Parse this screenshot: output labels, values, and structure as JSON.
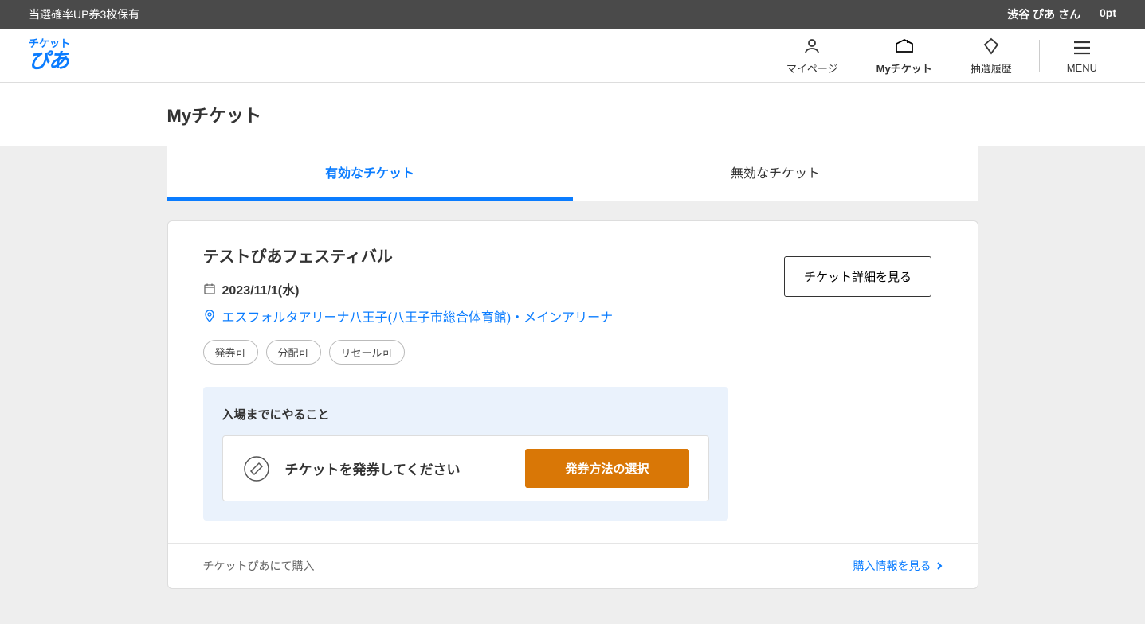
{
  "topbar": {
    "left": "当選確率UP券3枚保有",
    "username": "渋谷 ぴあ さん",
    "points": "0pt"
  },
  "logo": {
    "top": "チケット",
    "bottom": "ぴあ"
  },
  "nav": {
    "mypage": "マイページ",
    "myticket": "Myチケット",
    "lottery": "抽選履歴",
    "menu": "MENU"
  },
  "page": {
    "title": "Myチケット"
  },
  "tabs": {
    "valid": "有効なチケット",
    "invalid": "無効なチケット"
  },
  "ticket": {
    "title": "テストぴあフェスティバル",
    "date": "2023/11/1(水)",
    "venue": "エスフォルタアリーナ八王子(八王子市総合体育館)・メインアリーナ",
    "badges": [
      "発券可",
      "分配可",
      "リセール可"
    ],
    "detail_button": "チケット詳細を見る"
  },
  "todo": {
    "heading": "入場までにやること",
    "message": "チケットを発券してください",
    "action": "発券方法の選択"
  },
  "footer": {
    "purchased_at": "チケットぴあにて購入",
    "link": "購入情報を見る"
  }
}
